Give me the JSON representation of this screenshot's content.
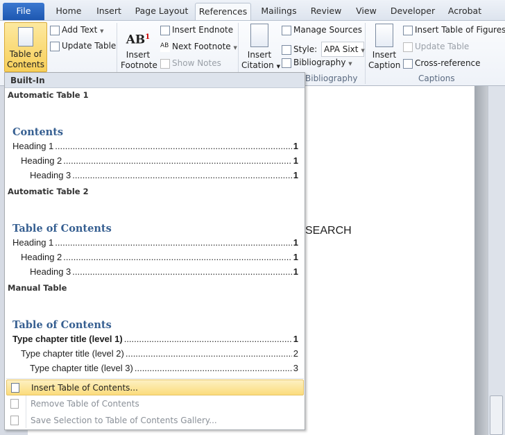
{
  "tabs": [
    "File",
    "Home",
    "Insert",
    "Page Layout",
    "References",
    "Mailings",
    "Review",
    "View",
    "Developer",
    "Acrobat"
  ],
  "active_tab": "References",
  "ribbon": {
    "toc": {
      "table_of_contents": [
        "Table of",
        "Contents"
      ],
      "add_text": "Add Text",
      "update_table": "Update Table"
    },
    "footnotes": {
      "insert_footnote": [
        "Insert",
        "Footnote"
      ],
      "insert_endnote": "Insert Endnote",
      "next_footnote": "Next Footnote",
      "show_notes": "Show Notes"
    },
    "citations": {
      "insert_citation": [
        "Insert",
        "Citation"
      ],
      "manage_sources": "Manage Sources",
      "style_label": "Style:",
      "style_value": "APA Sixt",
      "bibliography": "Bibliography",
      "group_label": "Bibliography"
    },
    "captions": {
      "insert_caption": [
        "Insert",
        "Caption"
      ],
      "insert_table_of_figures": "Insert Table of Figures",
      "update_table": "Update Table",
      "cross_reference": "Cross-reference",
      "group_label": "Captions"
    }
  },
  "document": {
    "visible_text": "SEARCH"
  },
  "menu": {
    "header": "Built-In",
    "sections": [
      {
        "title": "Automatic Table 1",
        "toc_title": "Contents",
        "lines": [
          {
            "text": "Heading 1",
            "page": "1"
          },
          {
            "text": "Heading 2",
            "page": "1"
          },
          {
            "text": "Heading 3",
            "page": "1"
          }
        ]
      },
      {
        "title": "Automatic Table 2",
        "toc_title": "Table of Contents",
        "lines": [
          {
            "text": "Heading 1",
            "page": "1"
          },
          {
            "text": "Heading 2",
            "page": "1"
          },
          {
            "text": "Heading 3",
            "page": "1"
          }
        ]
      },
      {
        "title": "Manual Table",
        "toc_title": "Table of Contents",
        "lines": [
          {
            "text": "Type chapter title (level 1)",
            "page": "1"
          },
          {
            "text": "Type chapter title (level 2)",
            "page": "2"
          },
          {
            "text": "Type chapter title (level 3)",
            "page": "3"
          }
        ]
      }
    ],
    "items": [
      {
        "label": "Insert Table of Contents...",
        "state": "highlighted"
      },
      {
        "label": "Remove Table of Contents",
        "state": "disabled"
      },
      {
        "label": "Save Selection to Table of Contents Gallery...",
        "state": "disabled"
      }
    ]
  },
  "colors": {
    "accent_highlight": "#fbdc7c",
    "toc_heading": "#365f91",
    "file_tab": "#2a63c0"
  }
}
